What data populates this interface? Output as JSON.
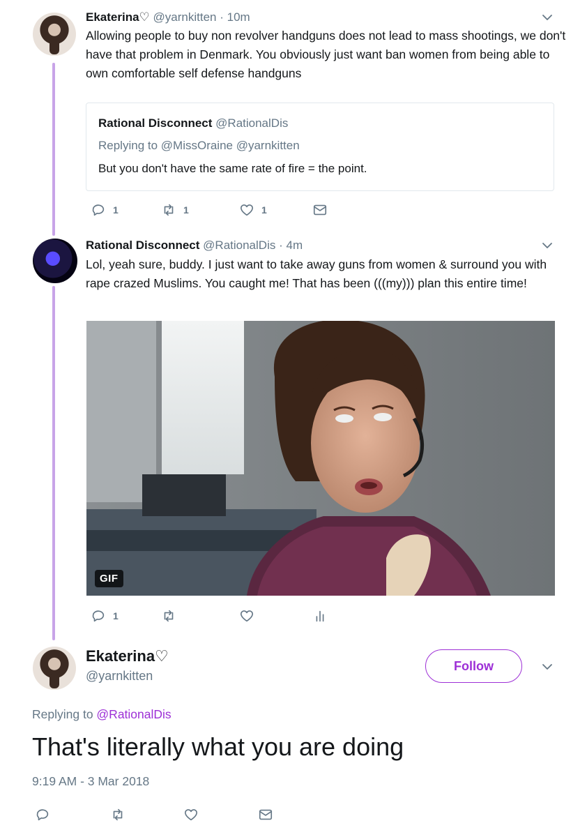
{
  "tweets": [
    {
      "name": "Ekaterina♡",
      "handle": "@yarnkitten",
      "dot": "·",
      "time": "10m",
      "text": "Allowing people to buy non revolver handguns does not lead to mass shootings, we don't have that problem in Denmark. You obviously just want ban women from being able to own comfortable self defense handguns",
      "quote": {
        "name": "Rational Disconnect",
        "handle": "@RationalDis",
        "replying": "Replying to @MissOraine @yarnkitten",
        "text": "But you don't have the same rate of fire = the point."
      },
      "actions": {
        "reply_count": "1",
        "retweet_count": "1",
        "like_count": "1"
      }
    },
    {
      "name": "Rational Disconnect",
      "handle": "@RationalDis",
      "dot": "·",
      "time": "4m",
      "text": "Lol, yeah sure, buddy. I just want to take away guns from women & surround you with rape crazed Muslims. You caught me! That has been (((my))) plan this entire time!",
      "media_badge": "GIF",
      "actions": {
        "reply_count": "1"
      }
    }
  ],
  "main_tweet": {
    "name": "Ekaterina♡",
    "handle": "@yarnkitten",
    "follow_label": "Follow",
    "replying_prefix": "Replying to ",
    "replying_link": "@RationalDis",
    "text": "That's literally what you are doing",
    "timestamp": "9:19 AM - 3 Mar 2018"
  },
  "colors": {
    "accent": "#9d2fd6",
    "thread_line": "#c8a4e8",
    "muted": "#657786"
  },
  "icons": [
    "reply-icon",
    "retweet-icon",
    "like-icon",
    "dm-icon",
    "analytics-icon",
    "chevron-down-icon"
  ]
}
